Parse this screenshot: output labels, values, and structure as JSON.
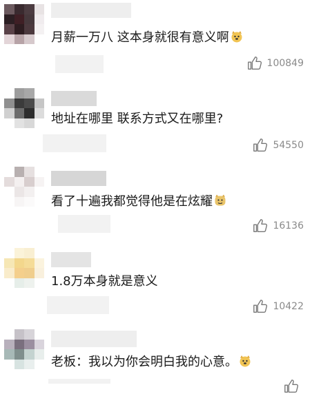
{
  "comments": [
    {
      "text": "月薪一万八 这本身就很有意义啊",
      "emoji": "dog-face-icon",
      "likes": "100849"
    },
    {
      "text": "地址在哪里 联系方式又在哪里?",
      "emoji": "",
      "likes": "54550"
    },
    {
      "text": "看了十遍我都觉得他是在炫耀",
      "emoji": "doge-icon",
      "likes": "16136"
    },
    {
      "text": "1.8万本身就是意义",
      "emoji": "",
      "likes": "10422"
    },
    {
      "text": "老板：我以为你会明白我的心意。",
      "emoji": "dog-face-icon",
      "likes": ""
    }
  ],
  "colors": {
    "text": "#1a1a1a",
    "likes": "#8a8a8a",
    "background": "#ffffff"
  }
}
